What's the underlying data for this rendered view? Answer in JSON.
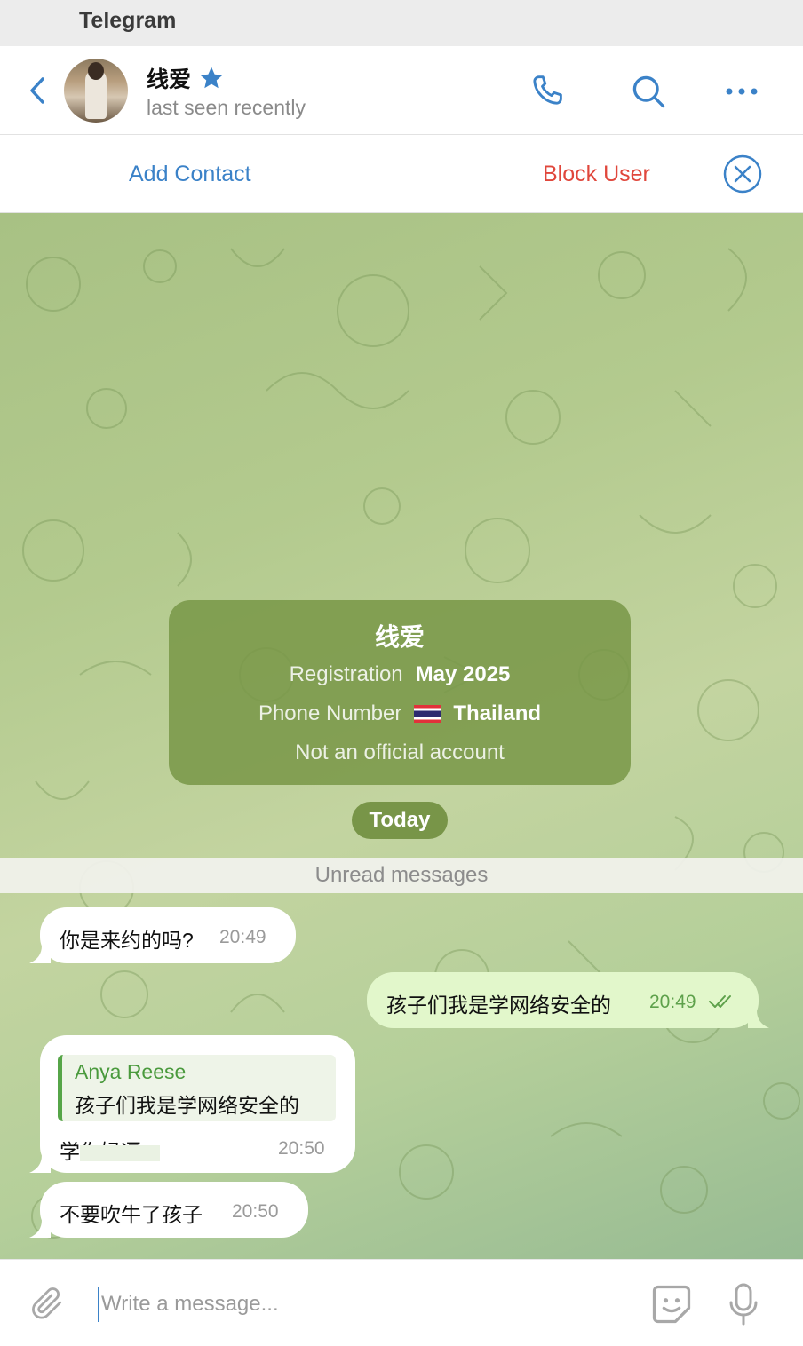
{
  "window": {
    "app_title": "Telegram"
  },
  "header": {
    "contact_name": "线爱",
    "status": "last seen recently"
  },
  "action_bar": {
    "add_contact": "Add Contact",
    "block_user": "Block User"
  },
  "info_card": {
    "name": "线爱",
    "registration_label": "Registration",
    "registration_value": "May 2025",
    "phone_label": "Phone Number",
    "phone_value": "Thailand",
    "official_note": "Not an official account"
  },
  "date_pill": "Today",
  "unread_label": "Unread messages",
  "messages": [
    {
      "direction": "in",
      "text": "你是来约的吗?",
      "time": "20:49"
    },
    {
      "direction": "out",
      "text": "孩子们我是学网络安全的",
      "time": "20:49",
      "status": "read"
    },
    {
      "direction": "in",
      "reply_author": "Anya Reese",
      "reply_text": "孩子们我是学网络安全的",
      "text": "学你妈逼",
      "time": "20:50"
    },
    {
      "direction": "in",
      "text": "不要吹牛了孩子",
      "time": "20:50"
    }
  ],
  "composer": {
    "placeholder": "Write a message..."
  },
  "colors": {
    "accent": "#3b82c8",
    "danger": "#e0473c",
    "outgoing_bubble": "#e2f7cb",
    "reply_author": "#4a9a3d"
  },
  "icons": {
    "back": "chevron-left-icon",
    "verified": "star-icon",
    "call": "phone-icon",
    "search": "search-icon",
    "more": "more-horizontal-icon",
    "close": "close-circle-icon",
    "attach": "paperclip-icon",
    "emoji": "sticker-icon",
    "mic": "microphone-icon"
  }
}
